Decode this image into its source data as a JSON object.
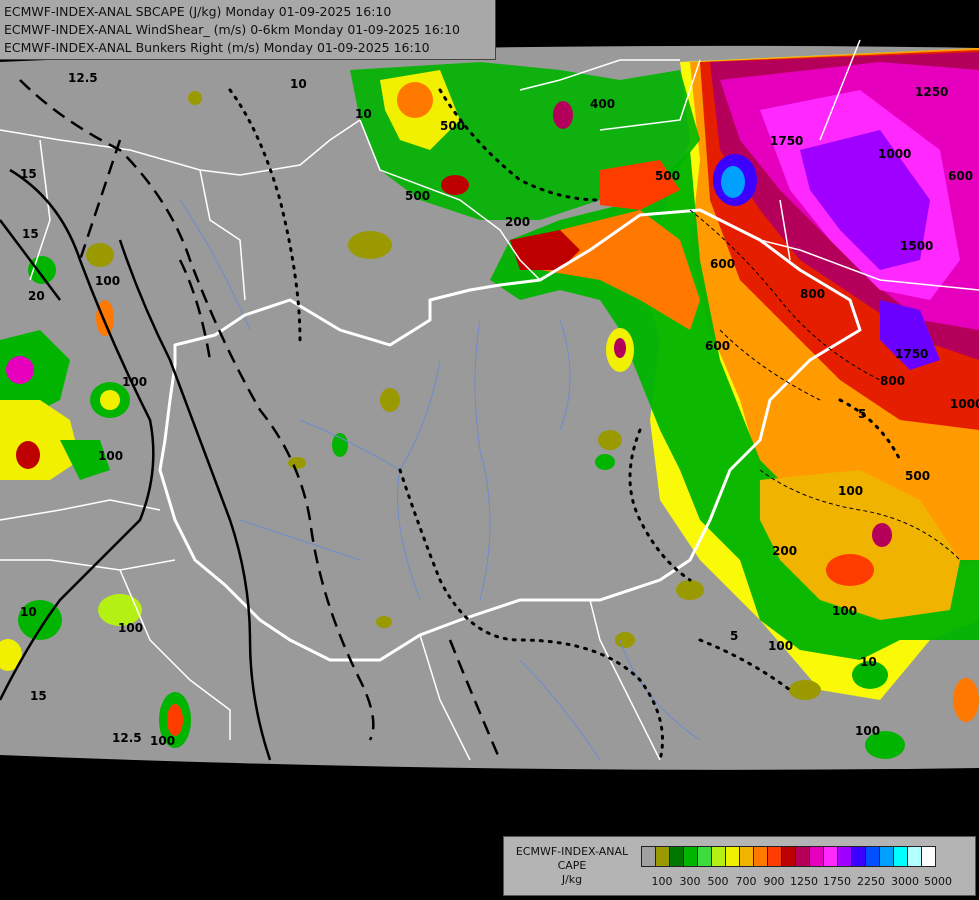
{
  "titles": [
    "ECMWF-INDEX-ANAL SBCAPE (J/kg) Monday 01-09-2025 16:10",
    "ECMWF-INDEX-ANAL WindShear_ (m/s) 0-6km Monday 01-09-2025 16:10",
    "ECMWF-INDEX-ANAL Bunkers Right (m/s) Monday 01-09-2025 16:10"
  ],
  "legend": {
    "caption": [
      "ECMWF-INDEX-ANAL",
      "CAPE",
      "J/kg"
    ],
    "colors": [
      "#a0a0a0",
      "#9a9a00",
      "#007800",
      "#00b400",
      "#3cdc3c",
      "#b4f014",
      "#f0f000",
      "#f0b400",
      "#ff7800",
      "#ff3c00",
      "#be0000",
      "#b4005a",
      "#e600be",
      "#ff28ff",
      "#a000ff",
      "#3c00ff",
      "#0050ff",
      "#00a0ff",
      "#00ffff",
      "#b4ffff",
      "#ffffff"
    ],
    "tick_labels": [
      "100",
      "300",
      "500",
      "700",
      "900",
      "1250",
      "1750",
      "2250",
      "3000",
      "5000"
    ]
  },
  "map": {
    "background": "#9a9a9a",
    "outside": "#000000",
    "border_color": "#ffffff",
    "river_color": "#6e8ccd",
    "contour_labels": [
      "12.5",
      "10",
      "15",
      "15",
      "20",
      "100",
      "100",
      "100",
      "10",
      "500",
      "500",
      "400",
      "200",
      "500",
      "600",
      "1750",
      "1000",
      "1250",
      "600",
      "1500",
      "800",
      "1750",
      "600",
      "800",
      "5",
      "1000",
      "100",
      "500",
      "200",
      "100",
      "100",
      "100",
      "5",
      "10",
      "100",
      "12.5",
      "15",
      "100",
      "10"
    ]
  }
}
